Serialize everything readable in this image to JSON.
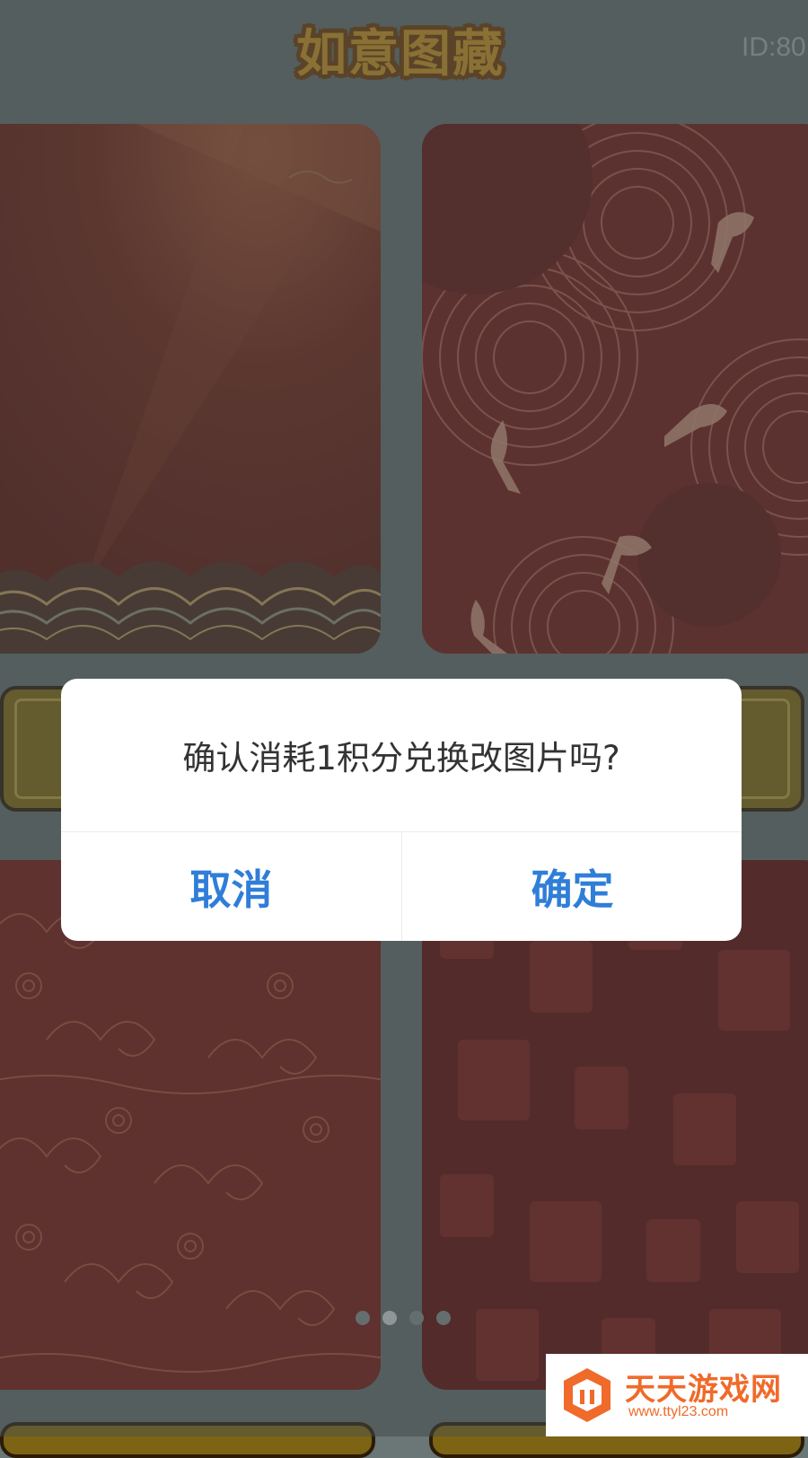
{
  "header": {
    "app_title": "如意图藏",
    "user_id": "ID:80"
  },
  "cards": [
    {
      "name": "card-golden-waves"
    },
    {
      "name": "card-koi-circles"
    },
    {
      "name": "card-auspicious-clouds"
    },
    {
      "name": "card-fu-characters"
    }
  ],
  "pagination": {
    "count": 4,
    "active_index": 1
  },
  "dialog": {
    "message": "确认消耗1积分兑换改图片吗?",
    "cancel_label": "取消",
    "confirm_label": "确定"
  },
  "watermark": {
    "title": "天天游戏网",
    "url": "www.ttyl23.com"
  },
  "colors": {
    "overlay": "#606a6a",
    "dialog_button": "#2f7ed8",
    "title_fill": "#c08a1e",
    "card_red": "#7a1a14",
    "watermark_orange": "#f06a2a"
  }
}
